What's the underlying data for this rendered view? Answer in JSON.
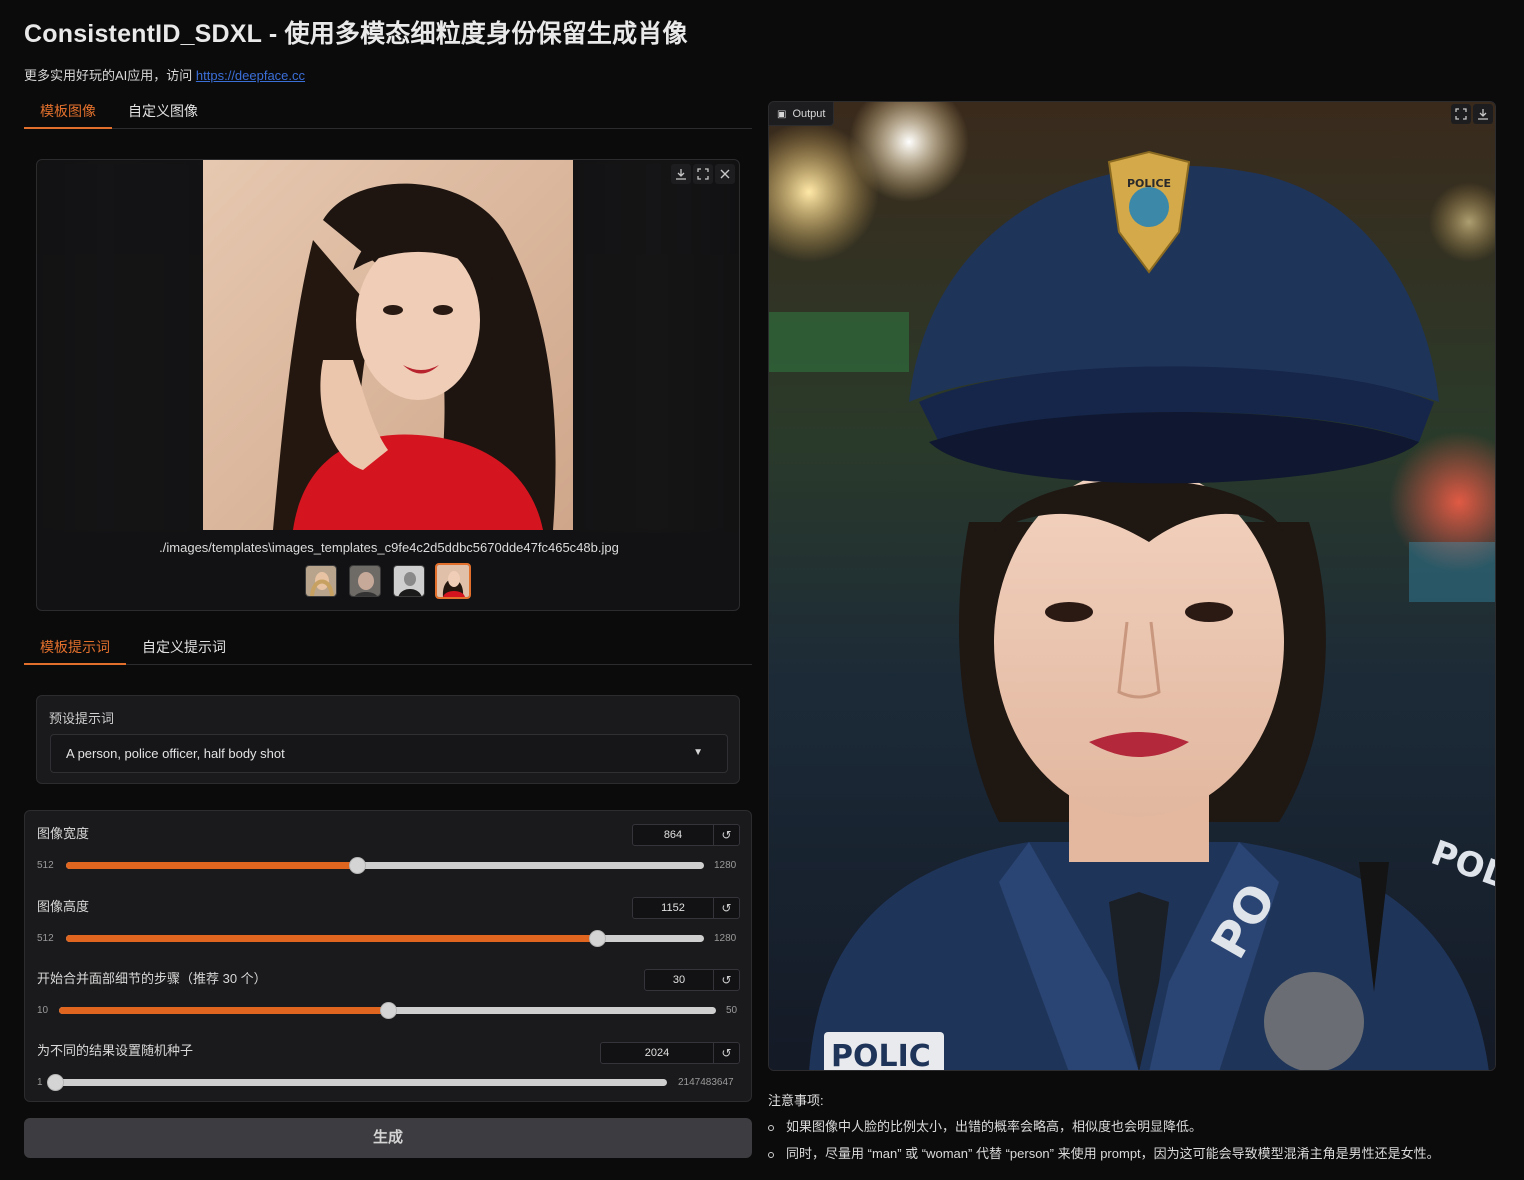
{
  "header": {
    "title": "ConsistentID_SDXL - 使用多模态细粒度身份保留生成肖像",
    "subtitle_prefix": "更多实用好玩的AI应用，访问 ",
    "subtitle_link": "https://deepface.cc"
  },
  "image_tabs": [
    {
      "label": "模板图像",
      "active": true
    },
    {
      "label": "自定义图像",
      "active": false
    }
  ],
  "gallery": {
    "selected_caption": "./images/templates\\images_templates_c9fe4c2d5ddbc5670dde47fc465c48b.jpg",
    "thumbnails": [
      {
        "name": "thumb-woman-blonde",
        "selected": false
      },
      {
        "name": "thumb-elderly-man",
        "selected": false
      },
      {
        "name": "thumb-man-suit",
        "selected": false
      },
      {
        "name": "thumb-woman-red",
        "selected": true
      }
    ],
    "icons": [
      "download-icon",
      "fullscreen-icon",
      "close-icon"
    ]
  },
  "prompt_tabs": [
    {
      "label": "模板提示词",
      "active": true
    },
    {
      "label": "自定义提示词",
      "active": false
    }
  ],
  "prompt": {
    "label": "预设提示词",
    "value": "A person, police officer, half body shot"
  },
  "sliders": [
    {
      "label": "图像宽度",
      "value": "864",
      "min": "512",
      "max": "1280",
      "fraction": 0.456
    },
    {
      "label": "图像高度",
      "value": "1152",
      "min": "512",
      "max": "1280",
      "fraction": 0.833
    },
    {
      "label": "开始合并面部细节的步骤（推荐 30 个）",
      "value": "30",
      "min": "10",
      "max": "50",
      "fraction": 0.5
    },
    {
      "label": "为不同的结果设置随机种子",
      "value": "2024",
      "min": "1",
      "max": "2147483647",
      "fraction": 0.0
    }
  ],
  "generate_button": "生成",
  "output": {
    "label": "Output",
    "badge_text": "POLICE",
    "chest_text": "PO",
    "shoulder_text": "POLC",
    "patch_text": "POLIC"
  },
  "notes": {
    "title": "注意事项:",
    "items": [
      "如果图像中人脸的比例太小，出错的概率会略高，相似度也会明显降低。",
      "同时，尽量用 “man” 或 “woman” 代替 “person” 来使用 prompt，因为这可能会导致模型混淆主角是男性还是女性。"
    ]
  },
  "colors": {
    "accent": "#e2702c",
    "background": "#0b0b0c",
    "panel": "#1a1a1c",
    "link": "#3b6fd8"
  }
}
